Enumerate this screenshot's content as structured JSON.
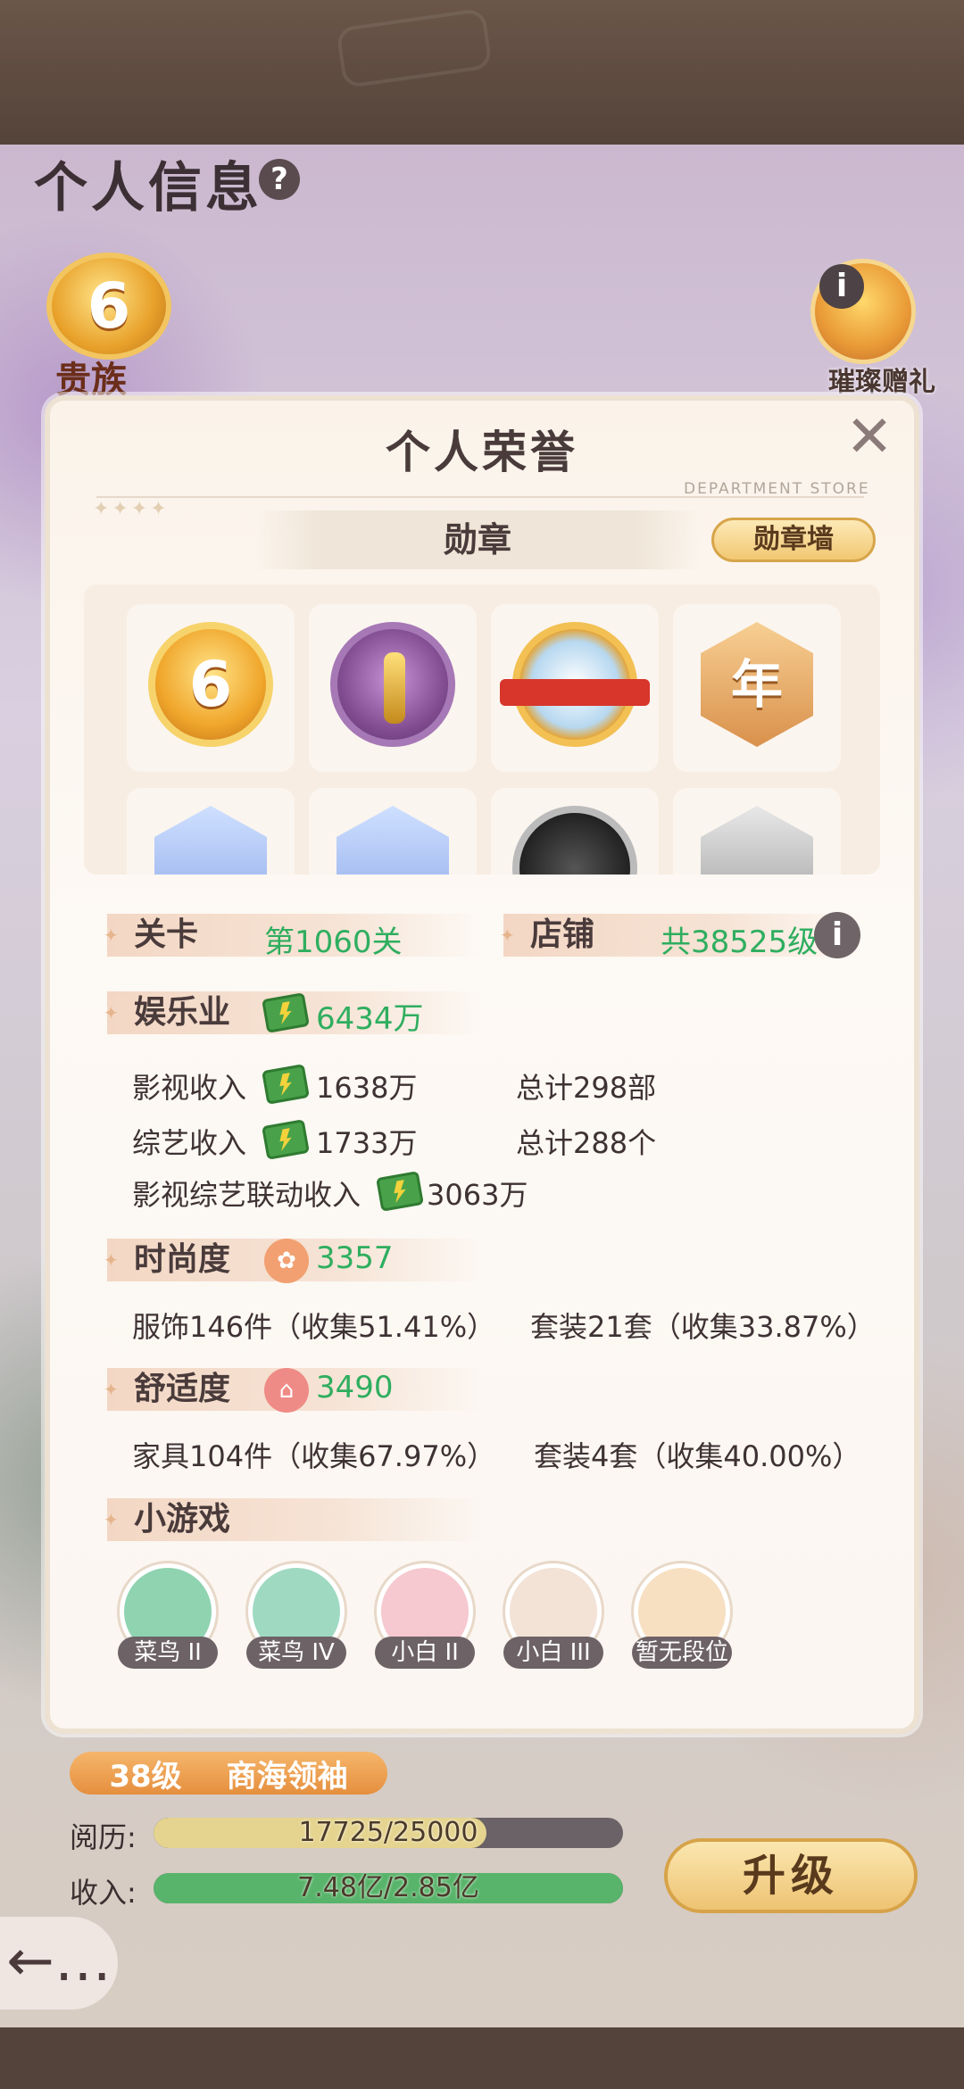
{
  "header": {
    "title": "个人信息",
    "help_icon": "?",
    "noble": {
      "level": "6",
      "label": "贵族"
    },
    "gift": {
      "label": "璀璨赠礼",
      "info_icon": "i"
    }
  },
  "panel": {
    "title": "个人荣誉",
    "subtitle": "DEPARTMENT STORE",
    "close_icon": "✕",
    "tab": "勋章",
    "medal_wall_button": "勋章墙",
    "medals_row1": [
      {
        "icon": "noble-6-medal",
        "text": "6"
      },
      {
        "icon": "oscar-film-medal",
        "text": ""
      },
      {
        "icon": "crown-medal",
        "text": ""
      },
      {
        "icon": "anniversary-medal",
        "text": "年"
      }
    ],
    "medals_row2": [
      {
        "icon": "blue-shield-medal-1"
      },
      {
        "icon": "blue-shield-medal-2"
      },
      {
        "icon": "dark-circle-medal"
      },
      {
        "icon": "silver-shield-medal"
      }
    ],
    "stage": {
      "label": "关卡",
      "value": "第1060关"
    },
    "shop": {
      "label": "店铺",
      "value": "共38525级",
      "info_icon": "i"
    },
    "entertainment": {
      "label": "娱乐业",
      "total": "6434万",
      "rows": [
        {
          "label": "影视收入",
          "value": "1638万",
          "extra": "总计298部"
        },
        {
          "label": "综艺收入",
          "value": "1733万",
          "extra": "总计288个"
        },
        {
          "label": "影视综艺联动收入",
          "value": "3063万",
          "extra": ""
        }
      ]
    },
    "fashion": {
      "label": "时尚度",
      "value": "3357",
      "detail_left": "服饰146件（收集51.41%）",
      "detail_right": "套装21套（收集33.87%）"
    },
    "comfort": {
      "label": "舒适度",
      "value": "3490",
      "detail_left": "家具104件（收集67.97%）",
      "detail_right": "套装4套（收集40.00%）"
    },
    "minigames": {
      "label": "小游戏",
      "items": [
        {
          "rank": "菜鸟 II",
          "icon": "grill-game-icon",
          "color": "#8fd3b1"
        },
        {
          "rank": "菜鸟 IV",
          "icon": "candy-jar-game-icon",
          "color": "#9fd9c2"
        },
        {
          "rank": "小白 II",
          "icon": "drink-game-icon",
          "color": "#f6c8cf"
        },
        {
          "rank": "小白 III",
          "icon": "burger-game-icon",
          "color": "#f3e2d6"
        },
        {
          "rank": "暂无段位",
          "icon": "cat-game-icon",
          "color": "#f7e0c2"
        }
      ]
    }
  },
  "footer": {
    "level": "38级",
    "title": "商海领袖",
    "experience_label": "阅历:",
    "experience_value": "17725/25000",
    "experience_fraction": 0.709,
    "income_label": "收入:",
    "income_value": "7.48亿/2.85亿",
    "income_fraction": 1.0,
    "upgrade_button": "升级",
    "back_icon": "←…"
  },
  "colors": {
    "accent_green": "#2fae5f",
    "experience_bar": "#e5d48f",
    "income_bar": "#58b46a"
  }
}
